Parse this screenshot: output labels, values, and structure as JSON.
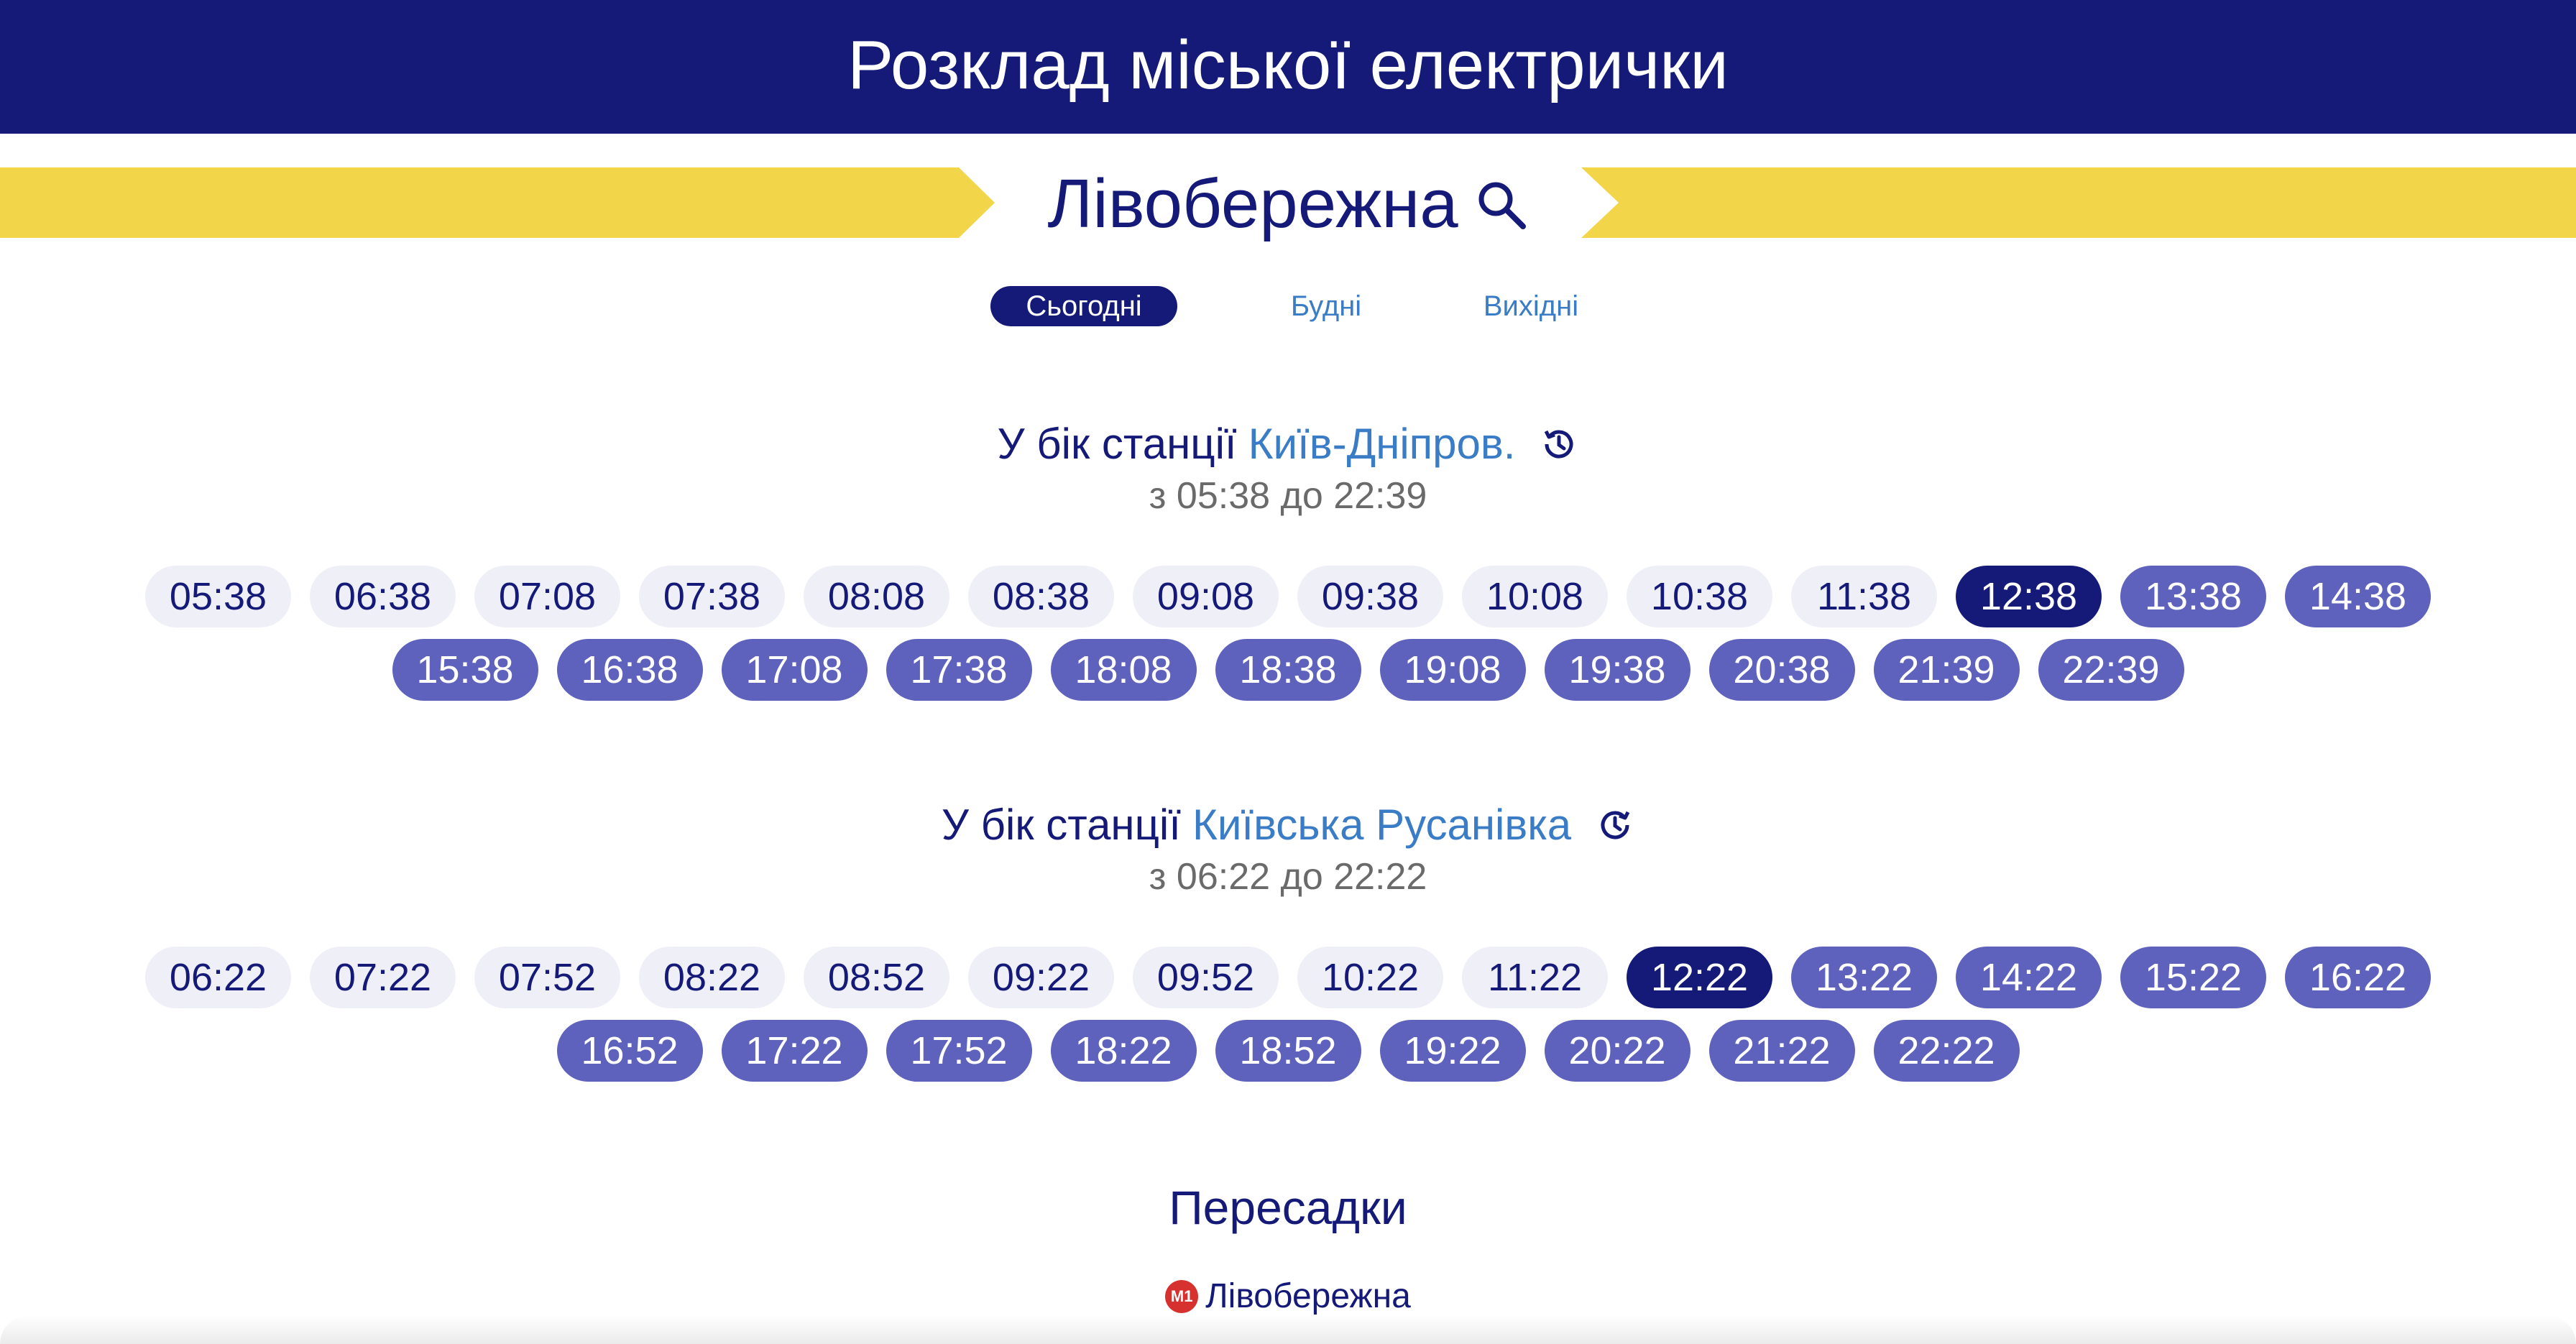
{
  "header": {
    "title": "Розклад міської електрички"
  },
  "station": {
    "name": "Лівобережна"
  },
  "tabs": [
    {
      "label": "Сьогодні",
      "active": true
    },
    {
      "label": "Будні",
      "active": false
    },
    {
      "label": "Вихідні",
      "active": false
    }
  ],
  "directions": [
    {
      "prefix": "У бік станції",
      "destination": "Київ-Дніпров.",
      "icon": "history-icon",
      "range": "з 05:38 до 22:39",
      "rows": [
        [
          "05:38",
          "06:38",
          "07:08",
          "07:38",
          "08:08",
          "08:38",
          "09:08",
          "09:38",
          "10:08",
          "10:38",
          "11:38",
          "12:38",
          "13:38",
          "14:38"
        ],
        [
          "15:38",
          "16:38",
          "17:08",
          "17:38",
          "18:08",
          "18:38",
          "19:08",
          "19:38",
          "20:38",
          "21:39",
          "22:39"
        ]
      ],
      "current": "12:38"
    },
    {
      "prefix": "У бік станції",
      "destination": "Київська Русанівка",
      "icon": "refresh-clock-icon",
      "range": "з 06:22 до 22:22",
      "rows": [
        [
          "06:22",
          "07:22",
          "07:52",
          "08:22",
          "08:52",
          "09:22",
          "09:52",
          "10:22",
          "11:22",
          "12:22",
          "13:22",
          "14:22",
          "15:22",
          "16:22"
        ],
        [
          "16:52",
          "17:22",
          "17:52",
          "18:22",
          "18:52",
          "19:22",
          "20:22",
          "21:22",
          "22:22"
        ]
      ],
      "current": "12:22"
    }
  ],
  "transfers": {
    "title": "Пересадки",
    "items": [
      {
        "badge": "M1",
        "name": "Лівобережна",
        "color": "#d6312f"
      }
    ]
  },
  "colors": {
    "header_bg": "#151a78",
    "banner": "#f3d54a",
    "accent_link": "#3a7cc6",
    "pill_past": "#efeff7",
    "pill_current": "#151a78",
    "pill_future": "#5e62bd"
  }
}
